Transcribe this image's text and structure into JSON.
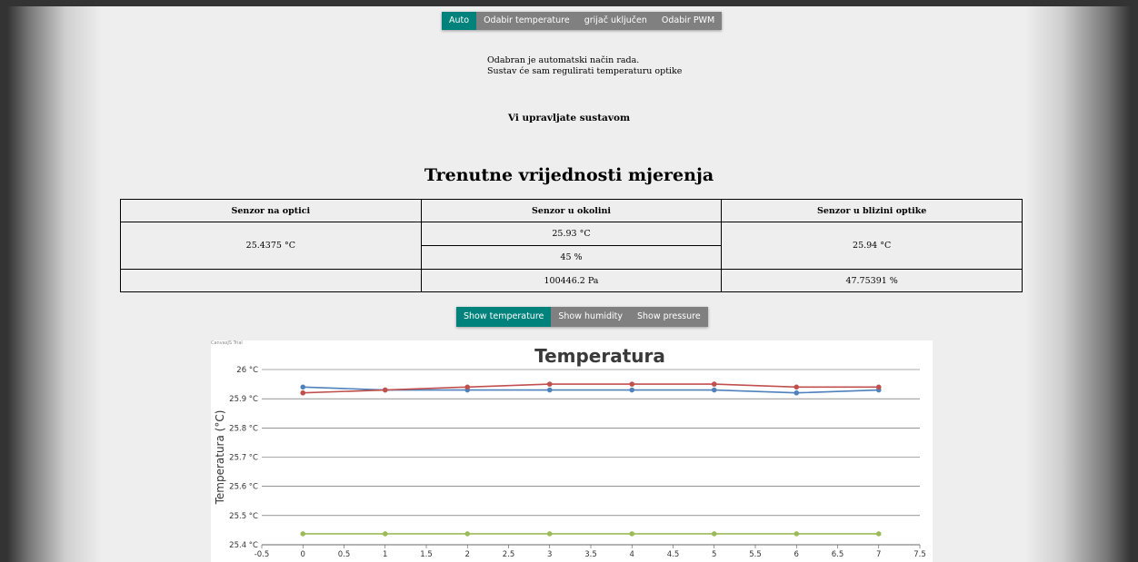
{
  "mode_tabs": [
    {
      "label": "Auto",
      "active": true
    },
    {
      "label": "Odabir temperature",
      "active": false
    },
    {
      "label": "grijač uključen",
      "active": false
    },
    {
      "label": "Odabir PWM",
      "active": false
    }
  ],
  "mode_description": {
    "line1": "Odabran je automatski način rada.",
    "line2": "Sustav će sam regulirati temperaturu optike"
  },
  "control_status": "Vi upravljate sustavom",
  "measurements": {
    "title": "Trenutne vrijednosti mjerenja",
    "headers": [
      "Senzor na optici",
      "Senzor u okolini",
      "Senzor u blizini optike"
    ],
    "optic_temperature": "25.4375 °C",
    "ambient_temperature": "25.93 °C",
    "ambient_humidity": "45 %",
    "ambient_pressure": "100446.2 Pa",
    "near_temperature": "25.94 °C",
    "near_humidity": "47.75391 %"
  },
  "chart_tabs": [
    {
      "label": "Show temperature",
      "active": true
    },
    {
      "label": "Show humidity",
      "active": false
    },
    {
      "label": "Show pressure",
      "active": false
    }
  ],
  "chart_watermark": "CanvasJS Trial",
  "colors": {
    "active_tab": "#00827c",
    "inactive_tab": "#808080",
    "series_blue": "#4f81bc",
    "series_red": "#c0504e",
    "series_green": "#9bbb58"
  },
  "chart_data": {
    "type": "line",
    "title": "Temperatura",
    "xlabel": "",
    "ylabel": "Temperatura (°C)",
    "xlim": [
      -0.5,
      7.5
    ],
    "ylim": [
      25.4,
      26
    ],
    "x_ticks": [
      "-0.5",
      "0",
      "0.5",
      "1",
      "1.5",
      "2",
      "2.5",
      "3",
      "3.5",
      "4",
      "4.5",
      "5",
      "5.5",
      "6",
      "6.5",
      "7",
      "7.5"
    ],
    "y_ticks": [
      "25.4 °C",
      "25.5 °C",
      "25.6 °C",
      "25.7 °C",
      "25.8 °C",
      "25.9 °C",
      "26 °C"
    ],
    "grid": true,
    "x": [
      0,
      1,
      2,
      3,
      4,
      5,
      6,
      7
    ],
    "series": [
      {
        "color": "#4f81bc",
        "values": [
          25.94,
          25.93,
          25.93,
          25.93,
          25.93,
          25.93,
          25.92,
          25.93
        ]
      },
      {
        "color": "#c0504e",
        "values": [
          25.92,
          25.93,
          25.94,
          25.95,
          25.95,
          25.95,
          25.94,
          25.94
        ]
      },
      {
        "color": "#9bbb58",
        "values": [
          25.4375,
          25.4375,
          25.4375,
          25.4375,
          25.4375,
          25.4375,
          25.4375,
          25.4375
        ]
      }
    ]
  }
}
